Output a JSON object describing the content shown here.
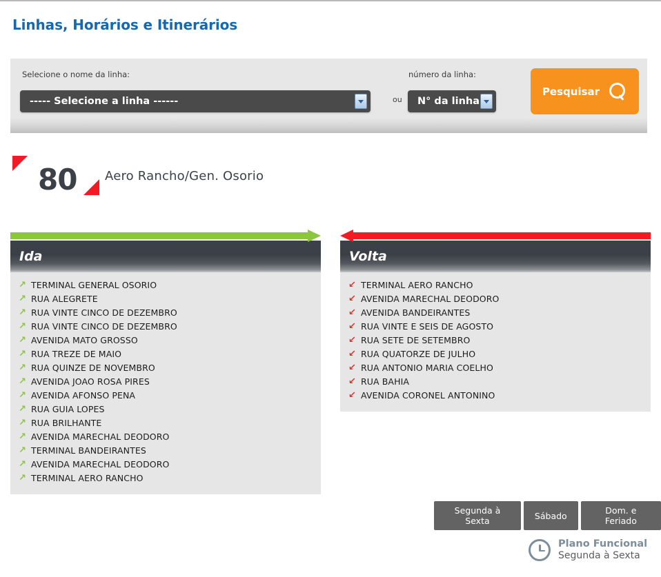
{
  "page": {
    "title": "Linhas, Horários e Itinerários"
  },
  "search": {
    "name_label": "Selecione o nome da linha:",
    "name_value": "----- Selecione a linha ------",
    "or_label": "ou",
    "number_label": "número da linha:",
    "number_value": "N° da linha",
    "submit_label": "Pesquisar",
    "submit_icon": "search-icon",
    "accent_color": "#f7921e"
  },
  "line": {
    "number": "80",
    "name": "Aero Rancho/Gen. Osorio",
    "marker_color": "#f31b23"
  },
  "directions": [
    {
      "title": "Ida",
      "arrow": "arrow-right",
      "color": "#8cc63e",
      "stop_icon": "arrow-up-right-icon",
      "stops": [
        "TERMINAL GENERAL OSORIO",
        "RUA ALEGRETE",
        "RUA VINTE CINCO DE DEZEMBRO",
        "RUA VINTE CINCO DE DEZEMBRO",
        "AVENIDA MATO GROSSO",
        "RUA TREZE DE MAIO",
        "RUA QUINZE DE NOVEMBRO",
        "AVENIDA JOAO ROSA PIRES",
        "AVENIDA AFONSO PENA",
        "RUA GUIA LOPES",
        "RUA BRILHANTE",
        "AVENIDA MARECHAL DEODORO",
        "TERMINAL BANDEIRANTES",
        "AVENIDA MARECHAL DEODORO",
        "TERMINAL AERO RANCHO"
      ]
    },
    {
      "title": "Volta",
      "arrow": "arrow-left",
      "color": "#f31b23",
      "stop_icon": "arrow-down-left-icon",
      "stops": [
        "TERMINAL AERO RANCHO",
        "AVENIDA MARECHAL DEODORO",
        "AVENIDA BANDEIRANTES",
        "RUA VINTE E SEIS DE AGOSTO",
        "RUA SETE DE SETEMBRO",
        "RUA QUATORZE DE JULHO",
        "RUA ANTONIO MARIA COELHO",
        "RUA BAHIA",
        "AVENIDA CORONEL ANTONINO"
      ]
    }
  ],
  "day_buttons": [
    "Segunda à Sexta",
    "Sábado",
    "Dom. e Feriado"
  ],
  "plan": {
    "icon": "clock-icon",
    "title": "Plano Funcional",
    "subtitle": "Segunda à Sexta"
  }
}
